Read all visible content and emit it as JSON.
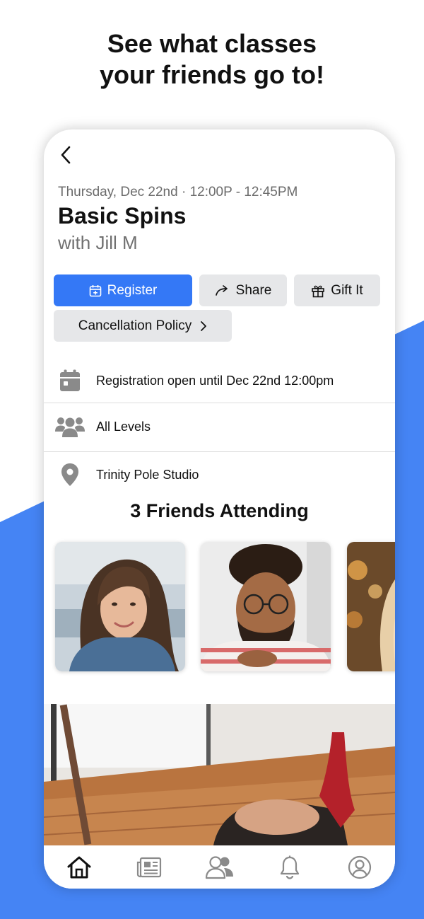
{
  "promo": {
    "headline_line1": "See what classes",
    "headline_line2": "your friends go to!",
    "accent_color": "#4584f4"
  },
  "class_detail": {
    "back_icon": "chevron-left-icon",
    "datetime": "Thursday, Dec 22nd · 12:00P - 12:45PM",
    "title": "Basic Spins",
    "instructor": "with Jill M"
  },
  "actions": {
    "register_label": "Register",
    "share_label": "Share",
    "gift_label": "Gift It",
    "cancellation_label": "Cancellation Policy",
    "primary_color": "#3478f6"
  },
  "info": {
    "registration": "Registration open until Dec 22nd 12:00pm",
    "level": "All Levels",
    "location": "Trinity Pole Studio"
  },
  "friends": {
    "heading": "3 Friends Attending",
    "items": [
      {
        "icon": "friend-photo-woman-brown-hair"
      },
      {
        "icon": "friend-photo-man-glasses"
      },
      {
        "icon": "friend-photo-blonde-partial"
      }
    ]
  },
  "tabbar": {
    "items": [
      {
        "icon": "home-icon",
        "active": true
      },
      {
        "icon": "news-icon",
        "active": false
      },
      {
        "icon": "friends-icon",
        "active": false
      },
      {
        "icon": "bell-icon",
        "active": false
      },
      {
        "icon": "profile-icon",
        "active": false
      }
    ]
  }
}
